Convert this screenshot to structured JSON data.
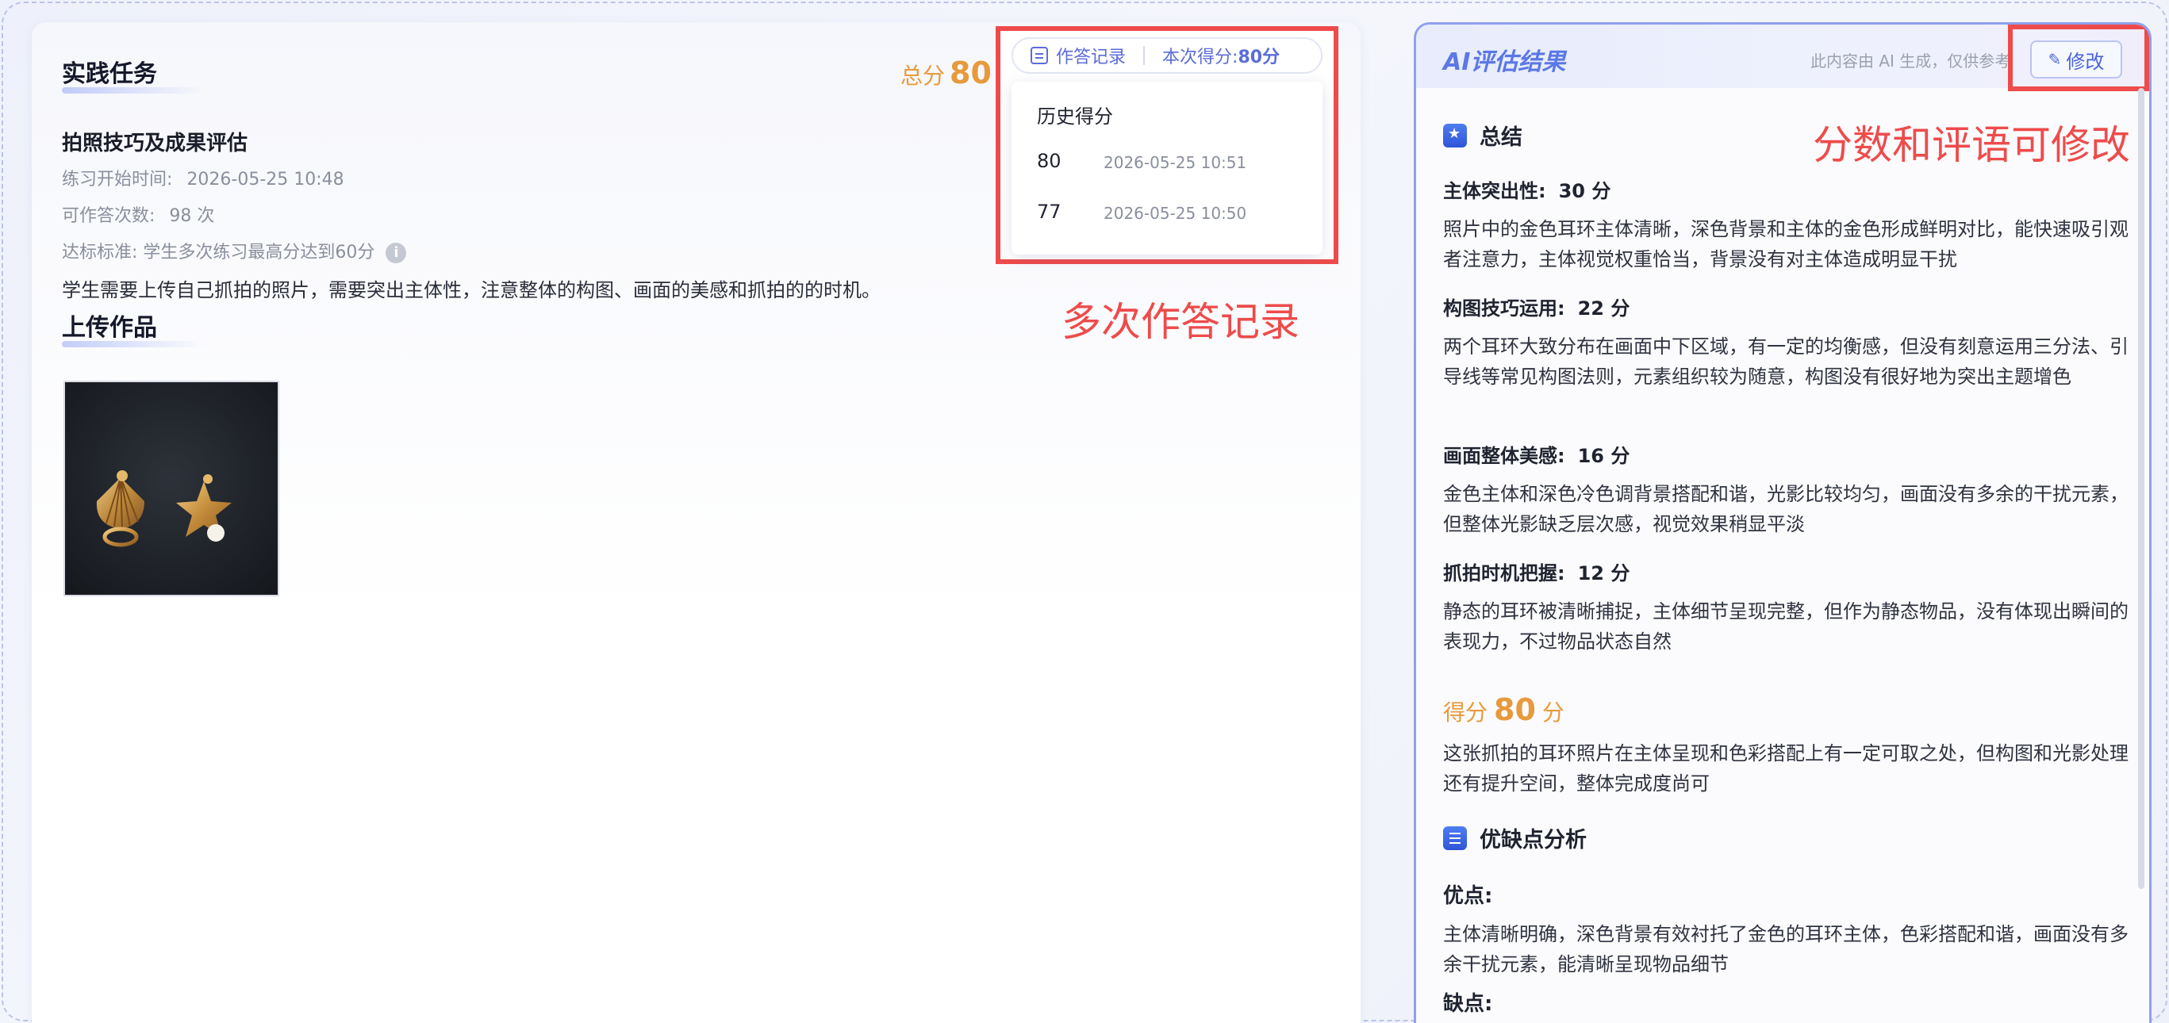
{
  "task": {
    "section_title": "实践任务",
    "name": "拍照技巧及成果评估",
    "start_label": "练习开始时间:",
    "start_value": "2026-05-25 10:48",
    "attempts_label": "可作答次数:",
    "attempts_value": "98 次",
    "standard": "达标标准: 学生多次练习最高分达到60分",
    "description": "学生需要上传自己抓拍的照片，需要突出主体性，注意整体的构图、画面的美感和抓拍的的时机。",
    "upload_title": "上传作品"
  },
  "total_score": {
    "prefix": "总分",
    "value": "80",
    "suffix": "分"
  },
  "record": {
    "link_label": "作答记录",
    "current_label": "本次得分:",
    "current_value": "80分",
    "history_title": "历史得分",
    "history": [
      {
        "score": "80",
        "date": "2026-05-25 10:51"
      },
      {
        "score": "77",
        "date": "2026-05-25 10:50"
      }
    ]
  },
  "annotations": {
    "left": "多次作答记录",
    "right": "分数和评语可修改"
  },
  "ai_panel": {
    "title": "AI评估结果",
    "note": "此内容由 AI 生成，仅供参考",
    "edit_label": "修改",
    "summary_title": "总结",
    "criteria": [
      {
        "label": "主体突出性:",
        "score": "30 分",
        "text": "照片中的金色耳环主体清晰，深色背景和主体的金色形成鲜明对比，能快速吸引观者注意力，主体视觉权重恰当，背景没有对主体造成明显干扰"
      },
      {
        "label": "构图技巧运用:",
        "score": "22 分",
        "text": "两个耳环大致分布在画面中下区域，有一定的均衡感，但没有刻意运用三分法、引导线等常见构图法则，元素组织较为随意，构图没有很好地为突出主题增色"
      },
      {
        "label": "画面整体美感:",
        "score": "16 分",
        "text": "金色主体和深色冷色调背景搭配和谐，光影比较均匀，画面没有多余的干扰元素，但整体光影缺乏层次感，视觉效果稍显平淡"
      },
      {
        "label": "抓拍时机把握:",
        "score": "12 分",
        "text": "静态的耳环被清晰捕捉，主体细节呈现完整，但作为静态物品，没有体现出瞬间的表现力，不过物品状态自然"
      }
    ],
    "final": {
      "prefix": "得分",
      "value": "80",
      "suffix": "分"
    },
    "summary_text": "这张抓拍的耳环照片在主体呈现和色彩搭配上有一定可取之处，但构图和光影处理还有提升空间，整体完成度尚可",
    "analysis_title": "优缺点分析",
    "pros_label": "优点:",
    "pros_text": "主体清晰明确，深色背景有效衬托了金色的耳环主体，色彩搭配和谐，画面没有多余干扰元素，能清晰呈现物品细节",
    "cons_label": "缺点:"
  },
  "colors": {
    "accent": "#5b6bd8",
    "score": "#e79a3c",
    "annotation": "#ee4b4b"
  }
}
